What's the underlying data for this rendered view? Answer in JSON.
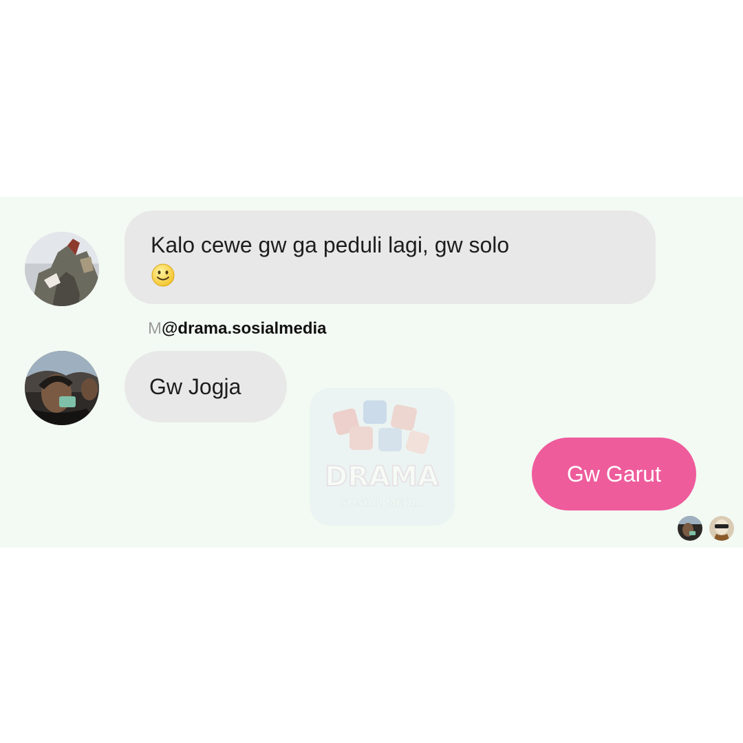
{
  "messages": [
    {
      "direction": "incoming",
      "text": "Kalo cewe gw ga peduli lagi, gw solo",
      "emoji": "slightly-smiling-face-icon"
    },
    {
      "direction": "incoming",
      "text": "Gw Jogja"
    },
    {
      "direction": "outgoing",
      "text": "Gw Garut"
    }
  ],
  "sender_label": {
    "faded_prefix": "M",
    "handle": "@drama.sosialmedia"
  },
  "watermark": {
    "title": "DRAMA",
    "subtitle": "SOSIAL MEDIA"
  },
  "colors": {
    "panel_background": "#f3faf3",
    "incoming_bubble": "#e8e8e8",
    "outgoing_bubble": "#ee5c9c",
    "outgoing_text": "#ffffff"
  },
  "icons": {
    "avatar_1": "avatar-photo",
    "avatar_2": "avatar-photo",
    "seen_receipts": [
      "seen-avatar-photo",
      "seen-avatar-photo"
    ]
  }
}
